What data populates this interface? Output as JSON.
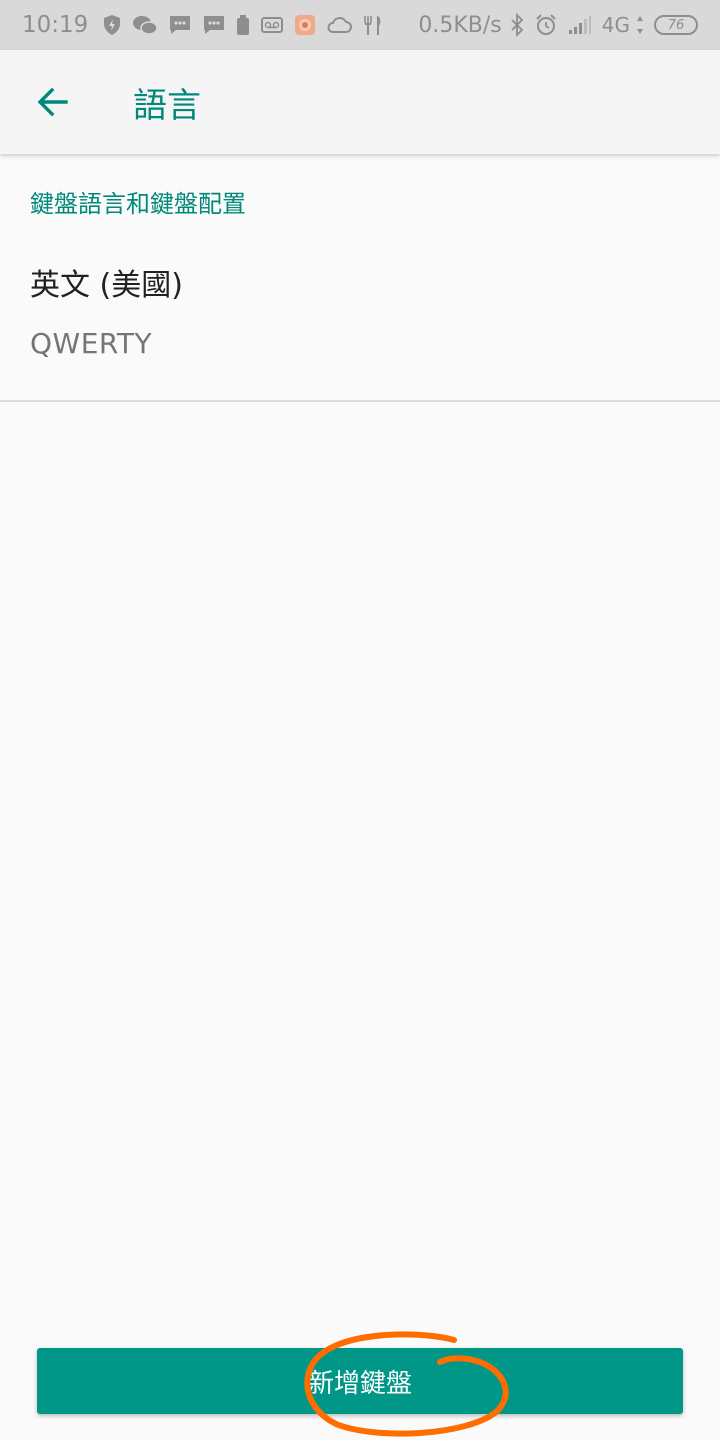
{
  "status_bar": {
    "time": "10:19",
    "net_speed": "0.5KB/s",
    "network_type": "4G",
    "battery_level": "76"
  },
  "app_bar": {
    "back_icon": "arrow-back-icon",
    "title": "語言"
  },
  "section": {
    "header": "鍵盤語言和鍵盤配置"
  },
  "keyboard_item": {
    "title": "英文 (美國)",
    "subtitle": "QWERTY"
  },
  "footer": {
    "add_keyboard_label": "新增鍵盤"
  },
  "colors": {
    "accent": "#00897b",
    "button": "#009688",
    "annotation": "#ff6d00"
  }
}
